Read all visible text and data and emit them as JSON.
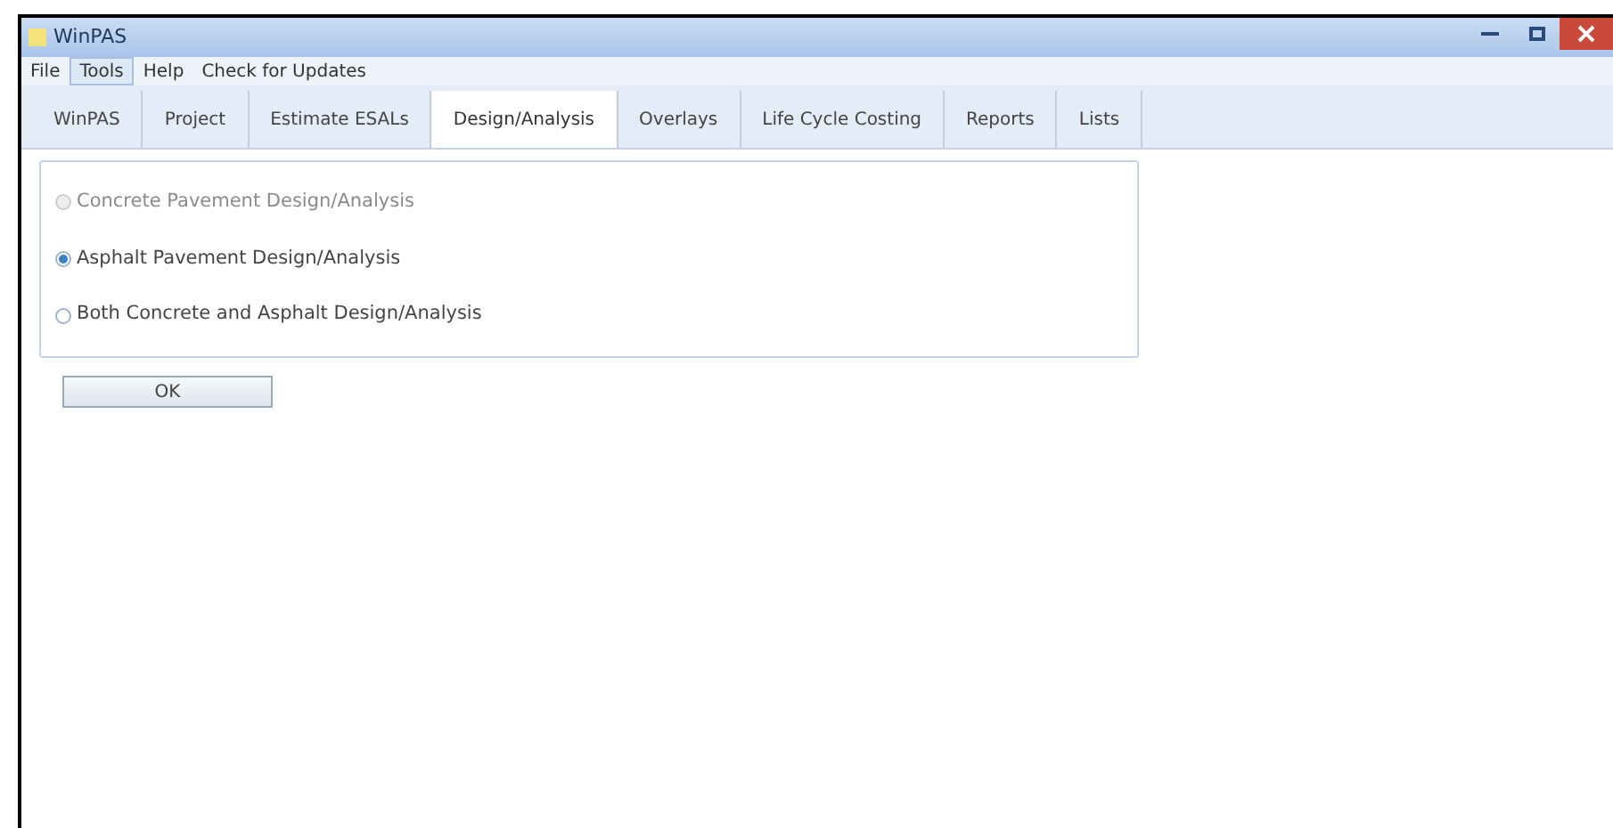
{
  "window": {
    "title": "WinPAS"
  },
  "menu": [
    {
      "label": "File",
      "selected": false
    },
    {
      "label": "Tools",
      "selected": true
    },
    {
      "label": "Help",
      "selected": false
    },
    {
      "label": "Check for Updates",
      "selected": false
    }
  ],
  "tabs": [
    {
      "label": "WinPAS",
      "selected": false
    },
    {
      "label": "Project",
      "selected": false
    },
    {
      "label": "Estimate ESALs",
      "selected": false
    },
    {
      "label": "Design/Analysis",
      "selected": true
    },
    {
      "label": "Overlays",
      "selected": false
    },
    {
      "label": "Life Cycle Costing",
      "selected": false
    },
    {
      "label": "Reports",
      "selected": false
    },
    {
      "label": "Lists",
      "selected": false
    }
  ],
  "options": [
    {
      "label": "Concrete Pavement Design/Analysis",
      "selected": false,
      "disabled": true
    },
    {
      "label": "Asphalt Pavement Design/Analysis",
      "selected": true,
      "disabled": false
    },
    {
      "label": "Both Concrete and Asphalt Design/Analysis",
      "selected": false,
      "disabled": false
    }
  ],
  "buttons": [
    "OK"
  ]
}
